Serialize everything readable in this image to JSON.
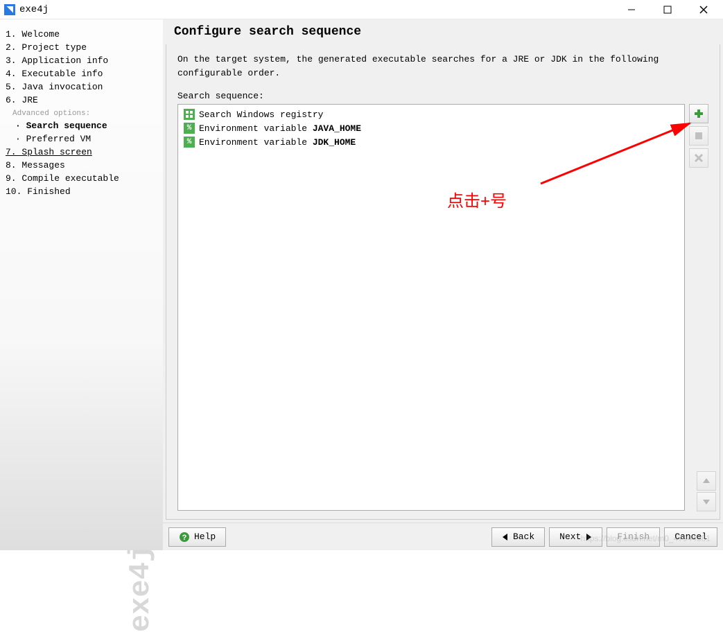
{
  "window": {
    "title": "exe4j"
  },
  "sidebar": {
    "items": [
      {
        "num": "1.",
        "label": "Welcome"
      },
      {
        "num": "2.",
        "label": "Project type"
      },
      {
        "num": "3.",
        "label": "Application info"
      },
      {
        "num": "4.",
        "label": "Executable info"
      },
      {
        "num": "5.",
        "label": "Java invocation"
      },
      {
        "num": "6.",
        "label": "JRE"
      }
    ],
    "advanced_label": "Advanced options:",
    "advanced_items": [
      {
        "bullet": "·",
        "label": "Search sequence",
        "active": true
      },
      {
        "bullet": "·",
        "label": "Preferred VM"
      }
    ],
    "items2": [
      {
        "num": "7.",
        "label": "Splash screen",
        "underline": true
      },
      {
        "num": "8.",
        "label": "Messages"
      },
      {
        "num": "9.",
        "label": "Compile executable"
      },
      {
        "num": "10.",
        "label": "Finished"
      }
    ],
    "watermark": "exe4j"
  },
  "main": {
    "title": "Configure search sequence",
    "description": "On the target system, the generated executable searches for a JRE or JDK in the following configurable order.",
    "seq_label": "Search sequence:",
    "rows": [
      {
        "icon": "reg",
        "prefix": "Search Windows registry",
        "bold": ""
      },
      {
        "icon": "env",
        "prefix": "Environment variable ",
        "bold": "JAVA_HOME"
      },
      {
        "icon": "env",
        "prefix": "Environment variable ",
        "bold": "JDK_HOME"
      }
    ]
  },
  "buttons": {
    "help": "Help",
    "back": "Back",
    "next": "Next",
    "finish": "Finish",
    "cancel": "Cancel"
  },
  "annotation": "点击+号",
  "footer_watermark": "https://blog.csdn.net/m0_47944381"
}
